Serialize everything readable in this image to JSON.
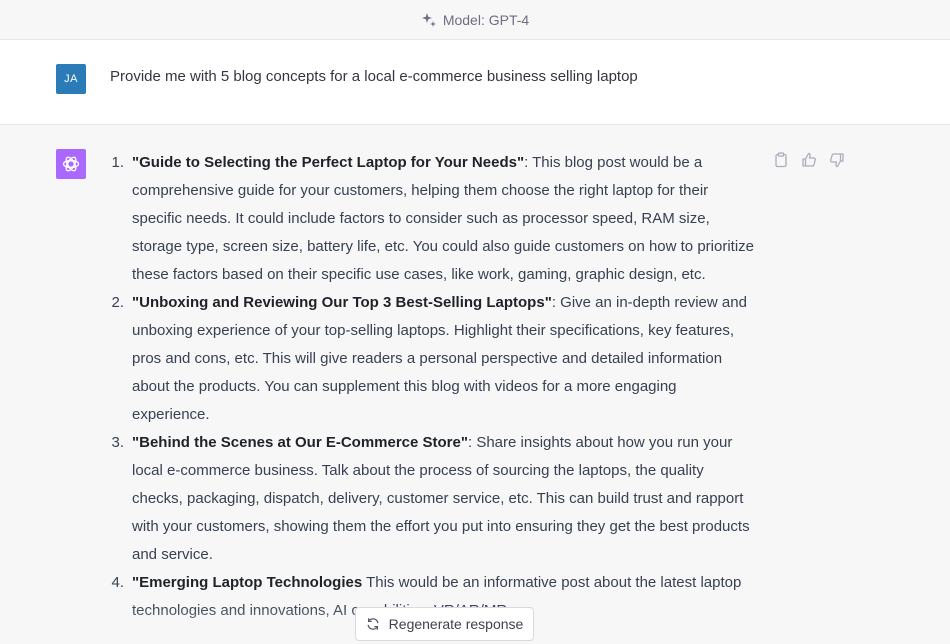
{
  "header": {
    "model_label": "Model: GPT-4",
    "icon": "sparkle-icon"
  },
  "user_message": {
    "avatar_initials": "JA",
    "avatar_color": "#2b7bb9",
    "text": "Provide me with 5 blog concepts for a local e-commerce business selling laptop"
  },
  "assistant_message": {
    "avatar_icon": "openai-logo-icon",
    "avatar_color": "#ab68ff",
    "items": [
      {
        "number": "1.",
        "title": "\"Guide to Selecting the Perfect Laptop for Your Needs\"",
        "body": ": This blog post would be a comprehensive guide for your customers, helping them choose the right laptop for their specific needs. It could include factors to consider such as processor speed, RAM size, storage type, screen size, battery life, etc. You could also guide customers on how to prioritize these factors based on their specific use cases, like work, gaming, graphic design, etc."
      },
      {
        "number": "2.",
        "title": "\"Unboxing and Reviewing Our Top 3 Best-Selling Laptops\"",
        "body": ": Give an in-depth review and unboxing experience of your top-selling laptops. Highlight their specifications, key features, pros and cons, etc. This will give readers a personal perspective and detailed information about the products. You can supplement this blog with videos for a more engaging experience."
      },
      {
        "number": "3.",
        "title": "\"Behind the Scenes at Our E-Commerce Store\"",
        "body": ": Share insights about how you run your local e-commerce business. Talk about the process of sourcing the laptops, the quality checks, packaging, dispatch, delivery, customer service, etc. This can build trust and rapport with your customers, showing them the effort you put into ensuring they get the best products and service."
      },
      {
        "number": "4.",
        "title": "\"Emerging Laptop Technologies",
        "body": "This would be an informative post about the latest laptop technologies and innovations, AI capabilities, VR/AR/MR"
      }
    ],
    "actions": {
      "copy_icon": "clipboard-icon",
      "thumbs_up_icon": "thumbs-up-icon",
      "thumbs_down_icon": "thumbs-down-icon"
    }
  },
  "regenerate": {
    "label": "Regenerate response",
    "icon": "refresh-icon"
  }
}
